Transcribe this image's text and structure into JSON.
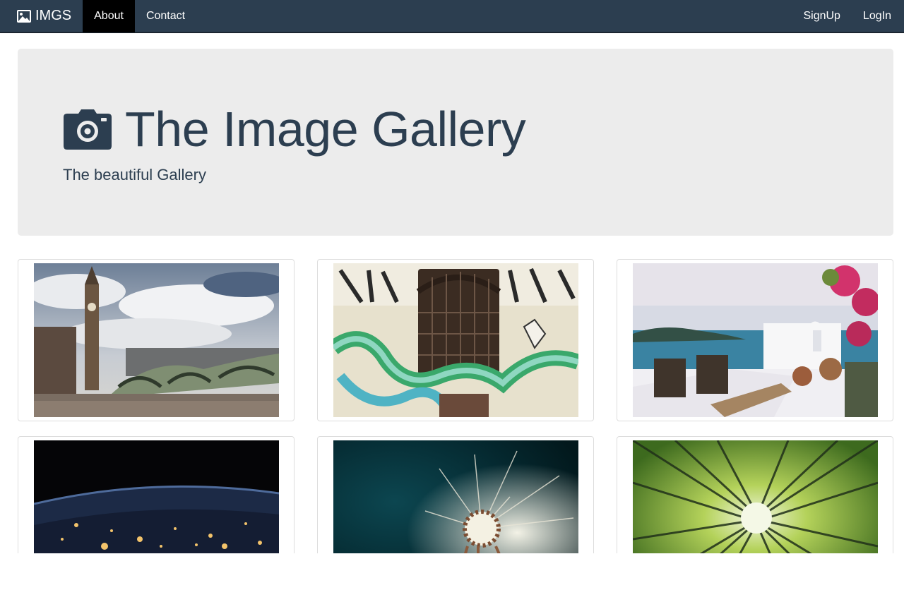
{
  "nav": {
    "brand": "IMGS",
    "links": [
      "About",
      "Contact"
    ],
    "right_links": [
      "SignUp",
      "LogIn"
    ]
  },
  "hero": {
    "title": "The Image Gallery",
    "subtitle": "The beautiful Gallery"
  },
  "gallery": {
    "images": [
      "london-big-ben-bridge",
      "graffiti-window-wall",
      "santorini-terrace-sea",
      "earth-night-lights",
      "dandelion-closeup",
      "bamboo-forest-canopy"
    ]
  },
  "colors": {
    "navbar": "#2c3e50",
    "active_tab": "#000000",
    "jumbotron": "#ececec",
    "heading": "#2c3e50"
  }
}
